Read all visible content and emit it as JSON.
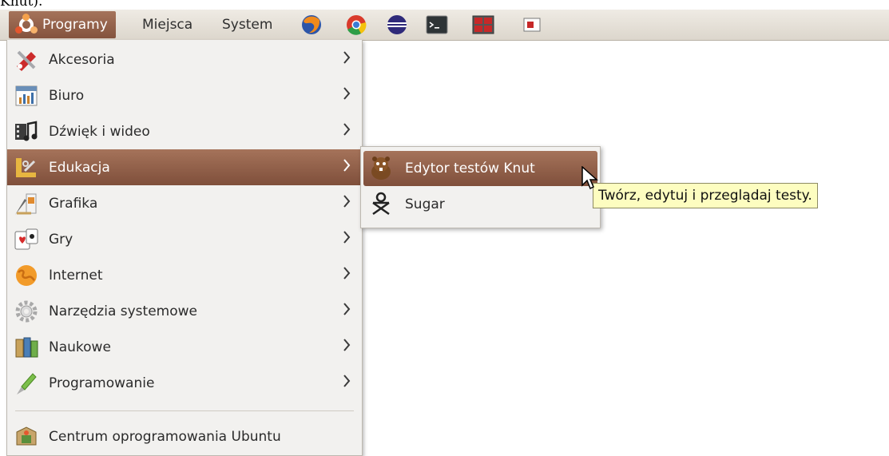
{
  "caption": "Knut).",
  "panel": {
    "menus": [
      "Programy",
      "Miejsca",
      "System"
    ],
    "launchers": [
      "firefox-icon",
      "chromium-icon",
      "eclipse-icon",
      "terminal-icon",
      "workspace-icon",
      "window-icon"
    ]
  },
  "menu": {
    "items": [
      {
        "label": "Akcesoria",
        "icon": "accessories-icon"
      },
      {
        "label": "Biuro",
        "icon": "office-icon"
      },
      {
        "label": "Dźwięk i wideo",
        "icon": "sound-video-icon"
      },
      {
        "label": "Edukacja",
        "icon": "education-icon"
      },
      {
        "label": "Grafika",
        "icon": "graphics-icon"
      },
      {
        "label": "Gry",
        "icon": "games-icon"
      },
      {
        "label": "Internet",
        "icon": "internet-icon"
      },
      {
        "label": "Narzędzia systemowe",
        "icon": "system-tools-icon"
      },
      {
        "label": "Naukowe",
        "icon": "science-icon"
      },
      {
        "label": "Programowanie",
        "icon": "programming-icon"
      }
    ],
    "footer": "Centrum oprogramowania Ubuntu"
  },
  "submenu": {
    "items": [
      {
        "label": "Edytor testów Knut",
        "icon": "beaver-icon"
      },
      {
        "label": "Sugar",
        "icon": "sugar-icon"
      }
    ]
  },
  "tooltip": "Twórz, edytuj i przeglądaj testy.",
  "colors": {
    "highlight": "#93624a",
    "panel": "#e6e1d8",
    "tooltip": "#fdfdc0"
  }
}
